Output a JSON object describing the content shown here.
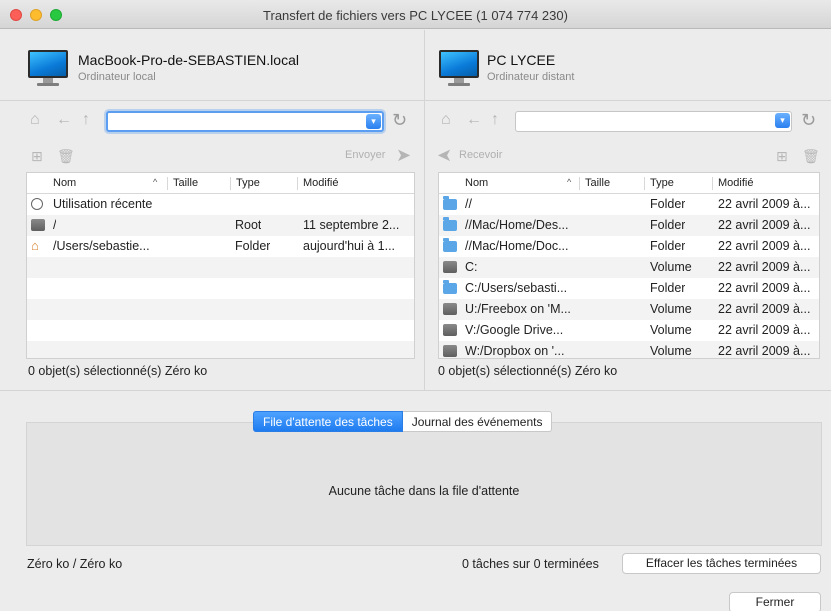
{
  "window": {
    "title": "Transfert de fichiers vers PC LYCEE (1 074 774 230)"
  },
  "local": {
    "name": "MacBook-Pro-de-SEBASTIEN.local",
    "subtitle": "Ordinateur local",
    "path_value": "",
    "send_label": "Envoyer",
    "columns": {
      "name": "Nom",
      "size": "Taille",
      "type": "Type",
      "modified": "Modifié"
    },
    "rows": [
      {
        "icon": "clock-icon",
        "name": "Utilisation récente",
        "type": "",
        "modified": ""
      },
      {
        "icon": "drive-icon",
        "name": "/",
        "type": "Root",
        "modified": "11 septembre 2..."
      },
      {
        "icon": "home-icon",
        "name": "/Users/sebastie...",
        "type": "Folder",
        "modified": "aujourd'hui à 1..."
      }
    ],
    "status": "0 objet(s) sélectionné(s)  Zéro ko"
  },
  "remote": {
    "name": "PC LYCEE",
    "subtitle": "Ordinateur distant",
    "path_value": "",
    "receive_label": "Recevoir",
    "columns": {
      "name": "Nom",
      "size": "Taille",
      "type": "Type",
      "modified": "Modifié"
    },
    "rows": [
      {
        "icon": "folder-icon",
        "name": "//",
        "type": "Folder",
        "modified": "22 avril 2009 à..."
      },
      {
        "icon": "folder-icon",
        "name": "//Mac/Home/Des...",
        "type": "Folder",
        "modified": "22 avril 2009 à..."
      },
      {
        "icon": "folder-icon",
        "name": "//Mac/Home/Doc...",
        "type": "Folder",
        "modified": "22 avril 2009 à..."
      },
      {
        "icon": "drive-icon",
        "name": "C:",
        "type": "Volume",
        "modified": "22 avril 2009 à..."
      },
      {
        "icon": "folder-icon",
        "name": "C:/Users/sebasti...",
        "type": "Folder",
        "modified": "22 avril 2009 à..."
      },
      {
        "icon": "drive-icon",
        "name": "U:/Freebox on 'M...",
        "type": "Volume",
        "modified": "22 avril 2009 à..."
      },
      {
        "icon": "drive-icon",
        "name": "V:/Google Drive...",
        "type": "Volume",
        "modified": "22 avril 2009 à..."
      },
      {
        "icon": "drive-icon",
        "name": "W:/Dropbox on '...",
        "type": "Volume",
        "modified": "22 avril 2009 à..."
      }
    ],
    "status": "0 objet(s) sélectionné(s)  Zéro ko"
  },
  "tasks": {
    "tab_queue": "File d'attente des tâches",
    "tab_log": "Journal des événements",
    "empty_message": "Aucune tâche dans la file d'attente",
    "totals": "Zéro ko / Zéro ko",
    "count": "0 tâches sur 0 terminées",
    "clear_button": "Effacer les tâches terminées"
  },
  "close_button": "Fermer",
  "colors": {
    "accent": "#2a80f0",
    "folder": "#5aa6e6"
  }
}
